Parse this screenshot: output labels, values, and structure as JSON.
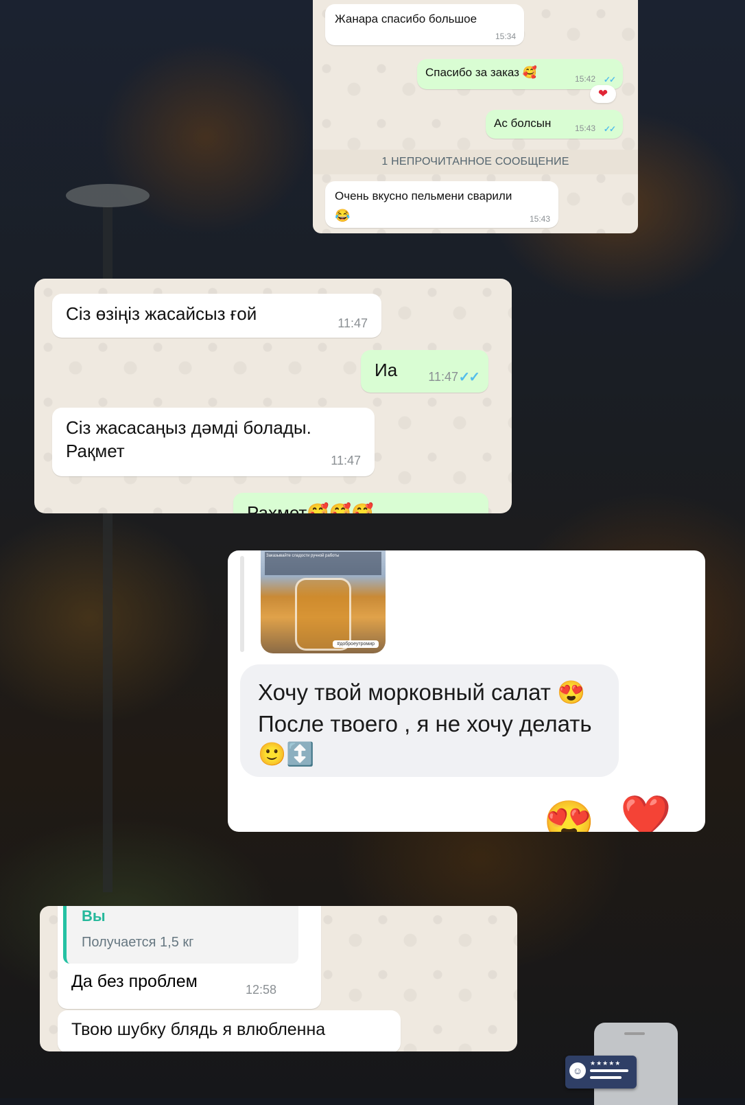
{
  "screen1": {
    "messages": [
      {
        "text": "Жанара спасибо большое",
        "time": "15:34"
      },
      {
        "text": "Спасибо за заказ 🥰",
        "time": "15:42",
        "status": "✓✓"
      },
      {
        "reaction": "❤"
      },
      {
        "text": "Ас болсын",
        "time": "15:43",
        "status": "✓✓"
      },
      {
        "text": "Очень вкусно пельмени сварили",
        "emoji": "😂",
        "time": "15:43"
      }
    ],
    "unread_label": "1 НЕПРОЧИТАННОЕ СООБЩЕНИЕ"
  },
  "screen2": {
    "messages": [
      {
        "text": "Сіз өзіңіз жасайсыз ғой",
        "time": "11:47"
      },
      {
        "text": "Иа",
        "time": "11:47",
        "status": "✓✓"
      },
      {
        "line1": "Сіз жасасаңыз дәмді болады.",
        "line2": "Рақмет",
        "time": "11:47"
      },
      {
        "text": "Рахмет🥰🥰🥰"
      }
    ]
  },
  "screen3": {
    "story_caption": "Заказывайте сладости ручной работы",
    "story_tag": "#доброеутромир",
    "line1": "Хочу твой морковный салат 😍",
    "line2": "После твоего ,  я не хочу делать",
    "line3": "🙂↕️",
    "reactions": [
      "😍",
      "❤️"
    ]
  },
  "screen4": {
    "quote_author": "Вы",
    "quote_text": "Получается 1,5 кг",
    "messages": [
      {
        "text": "Да без проблем",
        "time": "12:58"
      },
      {
        "text": "Твою шубку блядь я влюбленна"
      }
    ]
  },
  "overlay": {
    "stars": "★★★★★"
  }
}
